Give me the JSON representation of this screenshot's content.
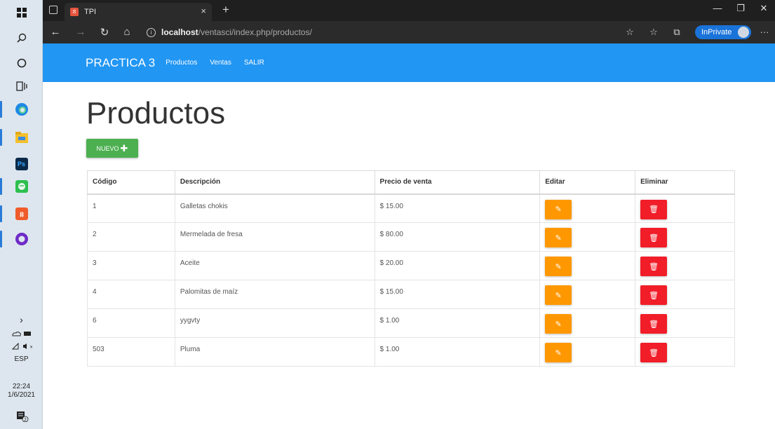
{
  "browser": {
    "tab_title": "TPI",
    "url_host": "localhost",
    "url_path": "/ventasci/index.php/productos/",
    "inprivate_label": "InPrivate"
  },
  "taskbar": {
    "language": "ESP",
    "time": "22:24",
    "date": "1/6/2021",
    "notification_count": "2"
  },
  "navbar": {
    "brand": "PRACTICA 3",
    "links": [
      "Productos",
      "Ventas",
      "SALIR"
    ]
  },
  "page": {
    "title": "Productos",
    "new_button": "NUEVO"
  },
  "table": {
    "headers": [
      "Código",
      "Descripción",
      "Precio de venta",
      "Editar",
      "Eliminar"
    ],
    "rows": [
      {
        "codigo": "1",
        "descripcion": "Galletas chokis",
        "precio": "$ 15.00"
      },
      {
        "codigo": "2",
        "descripcion": "Mermelada de fresa",
        "precio": "$ 80.00"
      },
      {
        "codigo": "3",
        "descripcion": "Aceite",
        "precio": "$ 20.00"
      },
      {
        "codigo": "4",
        "descripcion": "Palomitas de maíz",
        "precio": "$ 15.00"
      },
      {
        "codigo": "6",
        "descripcion": "yygvty",
        "precio": "$ 1.00"
      },
      {
        "codigo": "503",
        "descripcion": "Pluma",
        "precio": "$ 1.00"
      }
    ]
  },
  "colors": {
    "navbar": "#2196f3",
    "new_button": "#4caf50",
    "edit_button": "#ff9800",
    "delete_button": "#f11d28"
  },
  "icons": {
    "edit": "edit-icon",
    "delete": "trash-icon",
    "new": "plus-icon"
  }
}
